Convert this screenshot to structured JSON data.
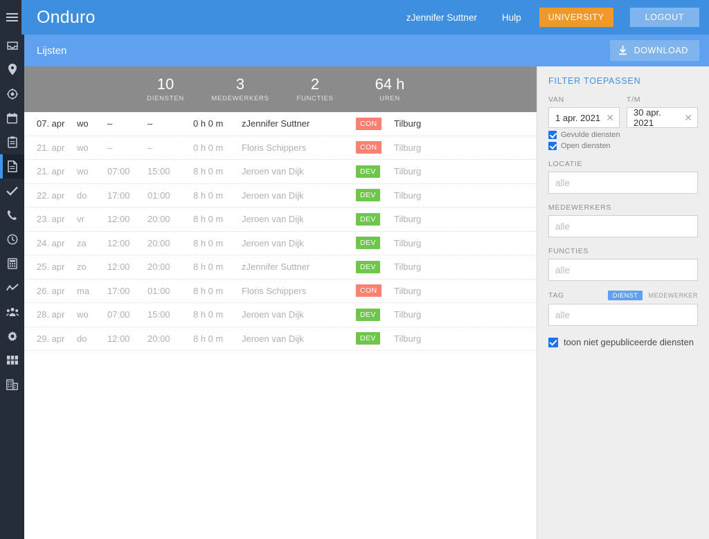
{
  "app": {
    "brand": "Onduro",
    "user": "zJennifer Suttner",
    "help_label": "Hulp",
    "org_button": "UNIVERSITY",
    "logout_button": "LOGOUT"
  },
  "subheader": {
    "title": "Lijsten",
    "download_label": "DOWNLOAD",
    "download_icon": "download-icon"
  },
  "rail": {
    "menu_icon": "hamburger-menu-icon",
    "items": [
      {
        "icon": "inbox-icon",
        "name": "inbox",
        "active": false
      },
      {
        "icon": "map-pin-icon",
        "name": "locations",
        "active": false
      },
      {
        "icon": "target-icon",
        "name": "radar",
        "active": false
      },
      {
        "icon": "calendar-icon",
        "name": "calendar",
        "active": false
      },
      {
        "icon": "clipboard-icon",
        "name": "clipboard",
        "active": false
      },
      {
        "icon": "document-icon",
        "name": "lists",
        "active": true
      },
      {
        "icon": "check-icon",
        "name": "approvals",
        "active": false
      },
      {
        "icon": "phone-icon",
        "name": "contacts",
        "active": false
      },
      {
        "icon": "clock-icon",
        "name": "timeclock",
        "active": false
      },
      {
        "icon": "calculator-icon",
        "name": "payroll",
        "active": false
      },
      {
        "icon": "chart-line-icon",
        "name": "reports",
        "active": false
      },
      {
        "icon": "people-icon",
        "name": "employees",
        "active": false
      },
      {
        "icon": "gear-icon",
        "name": "settings",
        "active": false
      },
      {
        "icon": "grid-icon",
        "name": "apps",
        "active": false
      },
      {
        "icon": "building-icon",
        "name": "organisation",
        "active": false
      }
    ]
  },
  "stats": [
    {
      "value": "10",
      "label": "DIENSTEN"
    },
    {
      "value": "3",
      "label": "MEDEWERKERS"
    },
    {
      "value": "2",
      "label": "FUNCTIES"
    },
    {
      "value": "64 h",
      "label": "UREN"
    }
  ],
  "table": {
    "rows": [
      {
        "date": "07. apr",
        "day": "wo",
        "start": "–",
        "end": "–",
        "duration": "0 h 0 m",
        "employee": "zJennifer Suttner",
        "tag": "CON",
        "tag_color": "con",
        "location": "Tilburg",
        "highlight": true
      },
      {
        "date": "21. apr",
        "day": "wo",
        "start": "–",
        "end": "–",
        "duration": "0 h 0 m",
        "employee": "Floris Schippers",
        "tag": "CON",
        "tag_color": "con",
        "location": "Tilburg",
        "highlight": false
      },
      {
        "date": "21. apr",
        "day": "wo",
        "start": "07:00",
        "end": "15:00",
        "duration": "8 h 0 m",
        "employee": "Jeroen van Dijk",
        "tag": "DEV",
        "tag_color": "dev",
        "location": "Tilburg",
        "highlight": false
      },
      {
        "date": "22. apr",
        "day": "do",
        "start": "17:00",
        "end": "01:00",
        "duration": "8 h 0 m",
        "employee": "Jeroen van Dijk",
        "tag": "DEV",
        "tag_color": "dev",
        "location": "Tilburg",
        "highlight": false
      },
      {
        "date": "23. apr",
        "day": "vr",
        "start": "12:00",
        "end": "20:00",
        "duration": "8 h 0 m",
        "employee": "Jeroen van Dijk",
        "tag": "DEV",
        "tag_color": "dev",
        "location": "Tilburg",
        "highlight": false
      },
      {
        "date": "24. apr",
        "day": "za",
        "start": "12:00",
        "end": "20:00",
        "duration": "8 h 0 m",
        "employee": "Jeroen van Dijk",
        "tag": "DEV",
        "tag_color": "dev",
        "location": "Tilburg",
        "highlight": false
      },
      {
        "date": "25. apr",
        "day": "zo",
        "start": "12:00",
        "end": "20:00",
        "duration": "8 h 0 m",
        "employee": "zJennifer Suttner",
        "tag": "DEV",
        "tag_color": "dev",
        "location": "Tilburg",
        "highlight": false
      },
      {
        "date": "26. apr",
        "day": "ma",
        "start": "17:00",
        "end": "01:00",
        "duration": "8 h 0 m",
        "employee": "Floris Schippers",
        "tag": "CON",
        "tag_color": "con",
        "location": "Tilburg",
        "highlight": false
      },
      {
        "date": "28. apr",
        "day": "wo",
        "start": "07:00",
        "end": "15:00",
        "duration": "8 h 0 m",
        "employee": "Jeroen van Dijk",
        "tag": "DEV",
        "tag_color": "dev",
        "location": "Tilburg",
        "highlight": false
      },
      {
        "date": "29. apr",
        "day": "do",
        "start": "12:00",
        "end": "20:00",
        "duration": "8 h 0 m",
        "employee": "Jeroen van Dijk",
        "tag": "DEV",
        "tag_color": "dev",
        "location": "Tilburg",
        "highlight": false
      }
    ]
  },
  "filter": {
    "title": "FILTER TOEPASSEN",
    "van_label": "VAN",
    "van_value": "1 apr. 2021",
    "tm_label": "T/M",
    "tm_value": "30 apr. 2021",
    "clear_icon": "close-icon",
    "check_filled": "Gevulde diensten",
    "check_open": "Open diensten",
    "locatie_label": "LOCATIE",
    "locatie_placeholder": "alle",
    "locatie_value": "",
    "medewerkers_label": "MEDEWERKERS",
    "medewerkers_placeholder": "alle",
    "medewerkers_value": "",
    "functies_label": "FUNCTIES",
    "functies_placeholder": "alle",
    "functies_value": "",
    "tag_label": "TAG",
    "tag_seg_dienst": "DIENST",
    "tag_seg_medewerker": "MEDEWERKER",
    "tag_placeholder": "alle",
    "tag_value": "",
    "unpublished_label": "toon niet gepubliceerde diensten"
  },
  "colors": {
    "header_blue": "#3f8fe0",
    "subheader_blue": "#5fa0f0",
    "accent_orange": "#f0982a",
    "rail_dark": "#252c3a",
    "stats_gray": "#8b8b8b",
    "tag_con": "#fa8072",
    "tag_dev": "#6ec64c",
    "panel_gray": "#eeeeee",
    "checkbox_blue": "#1a73e8"
  }
}
